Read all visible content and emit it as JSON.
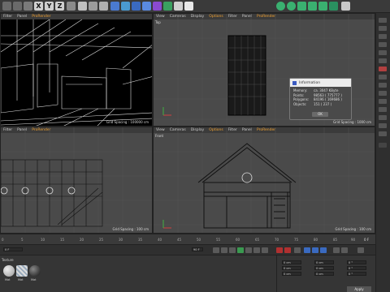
{
  "toolbar": {
    "axes": [
      "X",
      "Y",
      "Z"
    ]
  },
  "viewports": {
    "top_left": {
      "menu": [
        "Filter",
        "Panel",
        "ProRender"
      ],
      "grid": "Grid Spacing : 100000 cm"
    },
    "top_right": {
      "menu": [
        "View",
        "Cameras",
        "Display",
        "Options",
        "Filter",
        "Panel",
        "ProRender"
      ],
      "label": "Top",
      "grid": "Grid Spacing : 1000 cm"
    },
    "bottom_left": {
      "menu": [
        "Filter",
        "Panel",
        "ProRender"
      ],
      "grid": "Grid Spacing : 100 cm"
    },
    "bottom_right": {
      "menu": [
        "View",
        "Cameras",
        "Display",
        "Options",
        "Filter",
        "Panel",
        "ProRender"
      ],
      "label": "Front",
      "grid": "Grid Spacing : 100 cm"
    }
  },
  "info_dialog": {
    "title": "Information",
    "rows": [
      {
        "key": "Memory:",
        "value": "ca. 3047 KByte"
      },
      {
        "key": "Points:",
        "value": "98563 ( 775777 )"
      },
      {
        "key": "Polygons:",
        "value": "84196 ( 169686 )"
      },
      {
        "key": "Objects:",
        "value": "151 ( 237 )"
      }
    ],
    "ok_label": "OK"
  },
  "timeline": {
    "ticks": [
      "0",
      "5",
      "10",
      "15",
      "20",
      "25",
      "30",
      "35",
      "40",
      "45",
      "50",
      "55",
      "60",
      "65",
      "70",
      "75",
      "80",
      "85",
      "90"
    ],
    "frame_end": "0 F",
    "frame_start": "0 F",
    "frame_field": "90 F"
  },
  "materials": {
    "menu": "Texture",
    "items": [
      "Mat",
      "Mat",
      "Mat"
    ]
  },
  "coords": {
    "fields": [
      "0 cm",
      "0 cm",
      "0 cm",
      "0 cm",
      "0 cm",
      "0 cm",
      "0 °",
      "0 °",
      "0 °"
    ],
    "apply_label": "Apply"
  }
}
